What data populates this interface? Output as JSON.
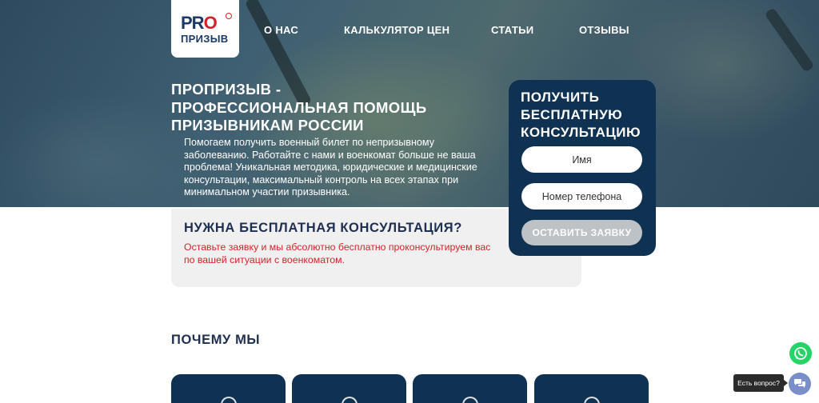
{
  "brand": {
    "logo_top": "PRO",
    "logo_bottom": "ПРИЗЫВ"
  },
  "nav": {
    "items": [
      {
        "label": "О НАС"
      },
      {
        "label": "КАЛЬКУЛЯТОР ЦЕН"
      },
      {
        "label": "СТАТЬИ"
      },
      {
        "label": "ОТЗЫВЫ"
      }
    ]
  },
  "hero": {
    "title": "ПРОПРИЗЫВ - ПРОФЕССИОНАЛЬНАЯ ПОМОЩЬ ПРИЗЫВНИКАМ РОССИИ",
    "text": "Помогаем получить военный билет по непризывному заболеванию. Работайте с нами и военкомат больше не ваша проблема! Уникальная методика, юридические и медицинские консультации, максимальный контроль на всех этапах при минимальном участии призывника."
  },
  "consult": {
    "title": "НУЖНА БЕСПЛАТНАЯ КОНСУЛЬТАЦИЯ?",
    "text": "Оставьте заявку и мы абсолютно бесплатно проконсультируем вас по вашей ситуации с военкоматом."
  },
  "form": {
    "title": "ПОЛУЧИТЬ БЕСПЛАТНУЮ КОНСУЛЬТАЦИЮ",
    "name_placeholder": "Имя",
    "phone_placeholder": "Номер телефона",
    "submit_label": "ОСТАВИТЬ ЗАЯВКУ"
  },
  "why": {
    "title": "ПОЧЕМУ МЫ"
  },
  "widgets": {
    "chat_label": "Есть вопрос?",
    "whatsapp_icon": "whatsapp-icon",
    "chat_icon": "chat-bubbles-icon",
    "whatsapp_color": "#25d366",
    "chat_color": "#7a8fc9"
  },
  "colors": {
    "brand_navy": "#0f3152",
    "accent_red": "#d2232a",
    "heading_dark": "#1e2f4f"
  }
}
